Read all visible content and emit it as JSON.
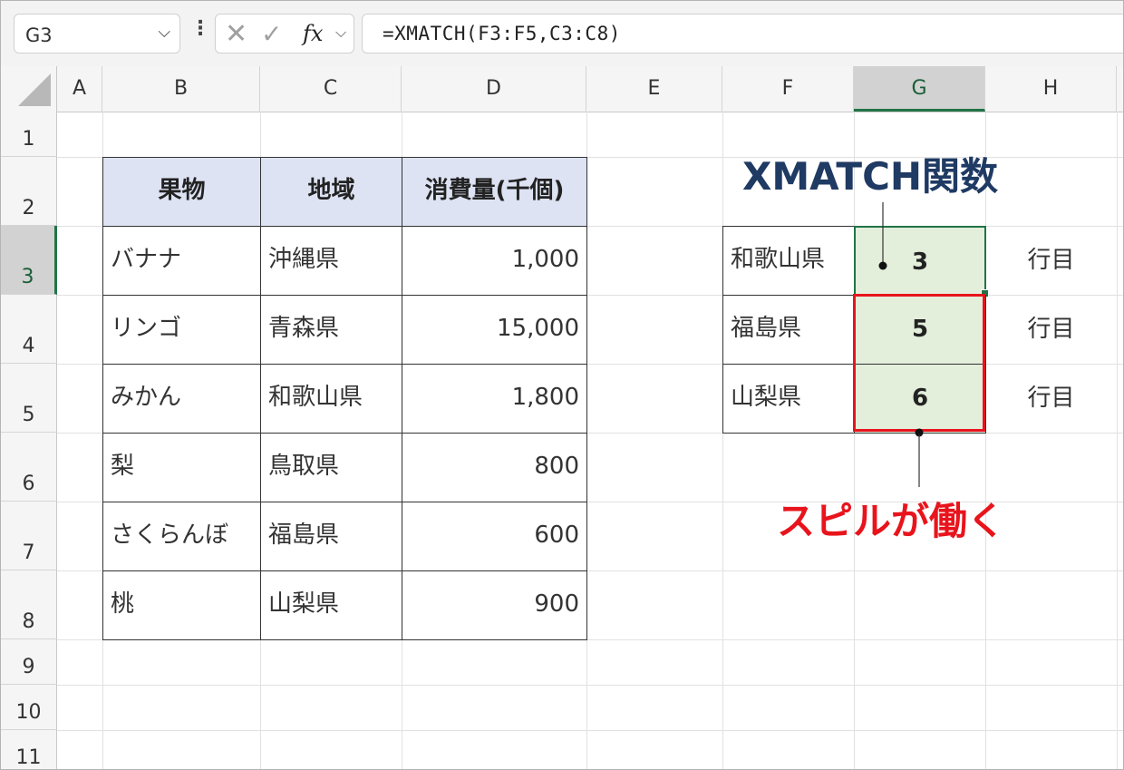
{
  "formula_bar": {
    "name_box": "G3",
    "fx_label": "fx",
    "formula": "=XMATCH(F3:F5,C3:C8)"
  },
  "columns": [
    "A",
    "B",
    "C",
    "D",
    "E",
    "F",
    "G",
    "H"
  ],
  "rows": [
    "1",
    "2",
    "3",
    "4",
    "5",
    "6",
    "7",
    "8",
    "9",
    "10",
    "11"
  ],
  "selected_cell": "G3",
  "table": {
    "headers": [
      "果物",
      "地域",
      "消費量(千個)"
    ],
    "rows": [
      [
        "バナナ",
        "沖縄県",
        "1,000"
      ],
      [
        "リンゴ",
        "青森県",
        "15,000"
      ],
      [
        "みかん",
        "和歌山県",
        "1,800"
      ],
      [
        "梨",
        "鳥取県",
        "800"
      ],
      [
        "さくらんぼ",
        "福島県",
        "600"
      ],
      [
        "桃",
        "山梨県",
        "900"
      ]
    ]
  },
  "lookup": {
    "rows": [
      {
        "key": "和歌山県",
        "result": "3",
        "suffix": "行目"
      },
      {
        "key": "福島県",
        "result": "5",
        "suffix": "行目"
      },
      {
        "key": "山梨県",
        "result": "6",
        "suffix": "行目"
      }
    ]
  },
  "annotations": {
    "function_label": "XMATCH関数",
    "spill_label": "スピルが働く"
  },
  "colors": {
    "header_fill": "#dde3f3",
    "result_fill": "#e3eedb",
    "accent_green": "#217346",
    "annotation_blue": "#1f3a63",
    "annotation_red": "#e8141c"
  }
}
